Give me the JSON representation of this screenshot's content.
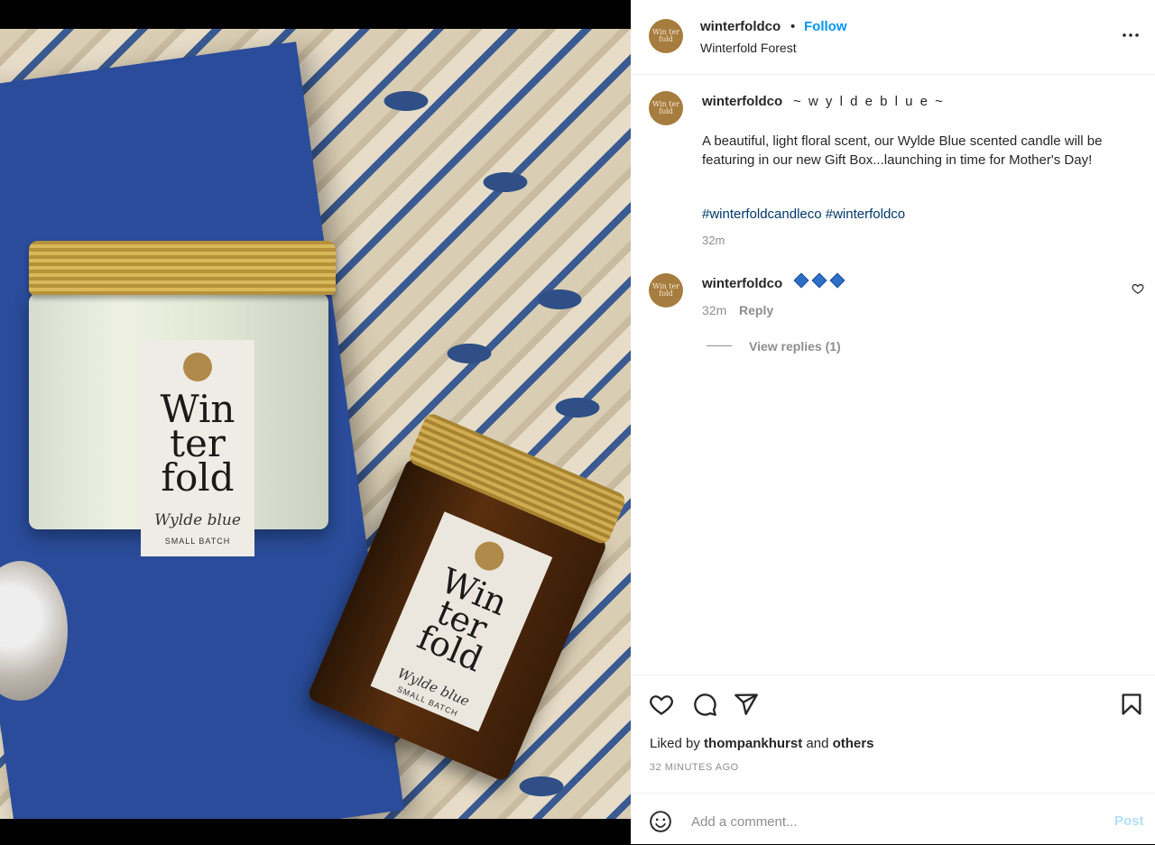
{
  "post": {
    "username": "winterfoldco",
    "dot": "•",
    "follow_label": "Follow",
    "location": "Winterfold Forest",
    "more_icon": "more-horizontal-icon"
  },
  "photo": {
    "label_brand_line1": "Win",
    "label_brand_line2": "ter",
    "label_brand_line3": "fold",
    "label_script": "Wylde blue",
    "label_small": "SMALL BATCH",
    "avatar_text": "Win ter fold"
  },
  "caption": {
    "username": "winterfoldco",
    "title": "~ w y l d e b l u e ~",
    "body": "A beautiful, light floral scent, our Wylde Blue scented candle will be featuring in our new Gift Box...launching in time for Mother's Day!",
    "hashtags": "#winterfoldcandleco #winterfoldco",
    "time": "32m"
  },
  "comment": {
    "username": "winterfoldco",
    "time": "32m",
    "reply_label": "Reply",
    "view_replies": "View replies (1)"
  },
  "actions": {
    "liked_prefix": "Liked by",
    "liked_user": "thompankhurst",
    "liked_and": "and",
    "liked_others": "others",
    "time_ago": "32 MINUTES AGO"
  },
  "comment_box": {
    "placeholder": "Add a comment...",
    "post_label": "Post"
  },
  "colors": {
    "accent": "#0095f6",
    "hashtag": "#00376b",
    "muted": "#8e8e8e",
    "post_disabled": "#b2dffc"
  }
}
